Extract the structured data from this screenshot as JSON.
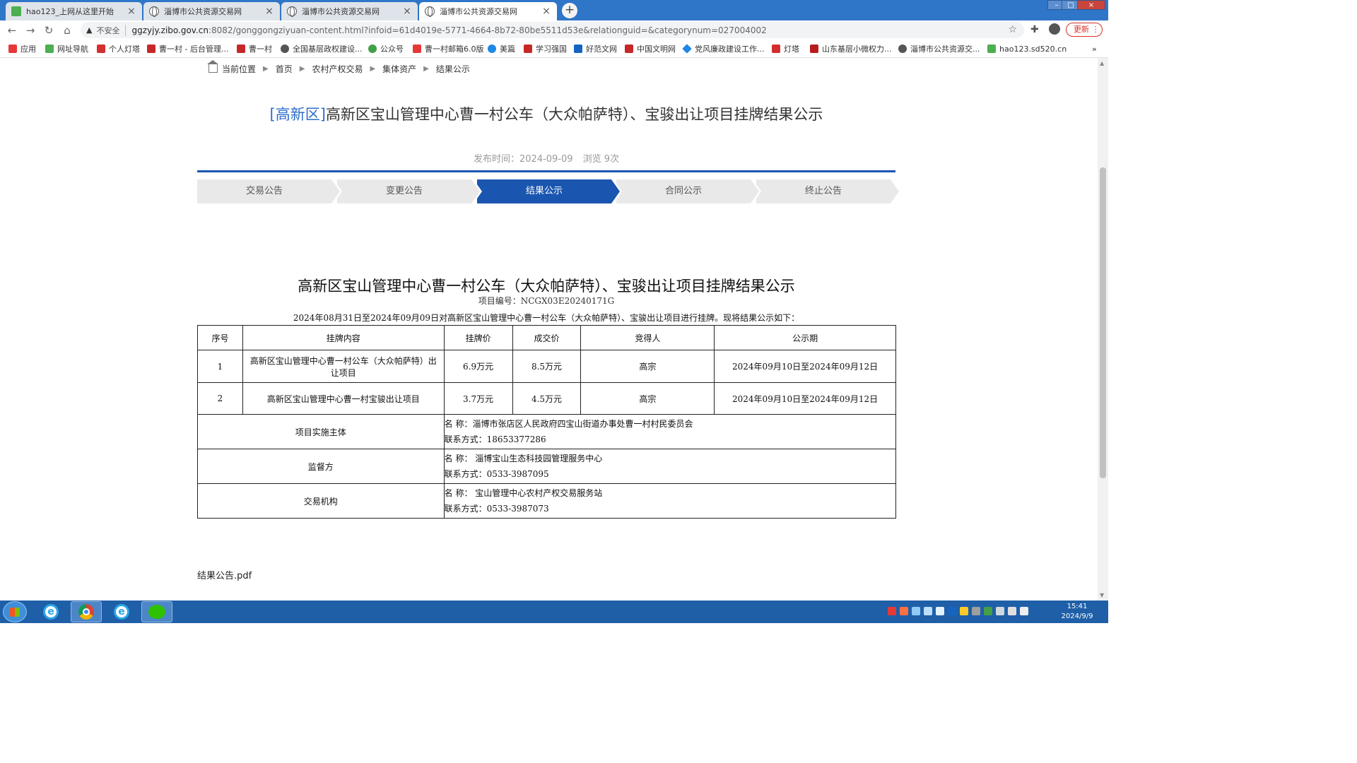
{
  "browser": {
    "tabs": [
      {
        "title": "hao123_上网从这里开始",
        "icon": "hao123-icon",
        "active": false
      },
      {
        "title": "淄博市公共资源交易网",
        "icon": "globe-icon",
        "active": false
      },
      {
        "title": "淄博市公共资源交易网",
        "icon": "globe-icon",
        "active": false
      },
      {
        "title": "淄博市公共资源交易网",
        "icon": "globe-icon",
        "active": true
      }
    ],
    "new_tab_label": "+",
    "close_glyph": "×",
    "window_controls": {
      "minimize": "–",
      "maximize": "□",
      "close": "×"
    },
    "nav": {
      "back": "←",
      "forward": "→",
      "reload": "↻",
      "home": "⌂"
    },
    "security_warning": "▲",
    "security_label": "不安全",
    "url_host": "ggzyjy.zibo.gov.cn",
    "url_rest": ":8082/gonggongziyuan-content.html?infoid=61d4019e-5771-4664-8b72-80be5511d53e&relationguid=&categorynum=027004002",
    "star_glyph": "☆",
    "extensions_glyph": "✚",
    "update_label": "更新 ⋮",
    "bookmarks": [
      {
        "label": "应用",
        "color": "#e53935"
      },
      {
        "label": "网址导航",
        "color": "#4caf50"
      },
      {
        "label": "个人灯塔",
        "color": "#d32f2f"
      },
      {
        "label": "曹一村 - 后台管理...",
        "color": "#c62828"
      },
      {
        "label": "曹一村",
        "color": "#c62828"
      },
      {
        "label": "全国基层政权建设...",
        "color": "#555555"
      },
      {
        "label": "公众号",
        "color": "#43a047"
      },
      {
        "label": "曹一村邮箱6.0版",
        "color": "#e53935"
      },
      {
        "label": "美篇",
        "color": "#1e88e5"
      },
      {
        "label": "学习强国",
        "color": "#c62828"
      },
      {
        "label": "好范文网",
        "color": "#1565c0"
      },
      {
        "label": "中国文明网",
        "color": "#c62828"
      },
      {
        "label": "党风廉政建设工作...",
        "color": "#1e88e5"
      },
      {
        "label": "灯塔",
        "color": "#d32f2f"
      },
      {
        "label": "山东基层小微权力...",
        "color": "#b71c1c"
      },
      {
        "label": "淄博市公共资源交...",
        "color": "#555555"
      },
      {
        "label": "hao123.sd520.cn",
        "color": "#4caf50"
      }
    ],
    "bookmarks_more": "»"
  },
  "breadcrumb": {
    "items": [
      "当前位置",
      "首页",
      "农村产权交易",
      "集体资产",
      "结果公示"
    ],
    "separator": "▶"
  },
  "header": {
    "district_tag": "[高新区]",
    "title": "高新区宝山管理中心曹一村公车（大众帕萨特）、宝骏出让项目挂牌结果公示",
    "publish_label": "发布时间：2024-09-09",
    "views_label": "浏览 9次"
  },
  "steps": [
    {
      "label": "交易公告",
      "active": false
    },
    {
      "label": "变更公告",
      "active": false
    },
    {
      "label": "结果公示",
      "active": true
    },
    {
      "label": "合同公示",
      "active": false
    },
    {
      "label": "终止公告",
      "active": false
    }
  ],
  "document": {
    "title": "高新区宝山管理中心曹一村公车（大众帕萨特）、宝骏出让项目挂牌结果公示",
    "project_code": "项目编号：NCGX03E20240171G",
    "intro": "2024年08月31日至2024年09月09日对高新区宝山管理中心曹一村公车（大众帕萨特）、宝骏出让项目进行挂牌。现将结果公示如下：",
    "table": {
      "headers": [
        "序号",
        "挂牌内容",
        "挂牌价",
        "成交价",
        "竞得人",
        "公示期"
      ],
      "rows": [
        {
          "no": "1",
          "content": "高新区宝山管理中心曹一村公车（大众帕萨特）出让项目",
          "list_price": "6.9万元",
          "deal_price": "8.5万元",
          "winner": "高宗",
          "period": "2024年09月10日至2024年09月12日"
        },
        {
          "no": "2",
          "content": "高新区宝山管理中心曹一村宝骏出让项目",
          "list_price": "3.7万元",
          "deal_price": "4.5万元",
          "winner": "高宗",
          "period": "2024年09月10日至2024年09月12日"
        }
      ],
      "info": [
        {
          "label": "项目实施主体",
          "name": "名 称：淄博市张店区人民政府四宝山街道办事处曹一村村民委员会",
          "contact": "联系方式：18653377286"
        },
        {
          "label": "监督方",
          "name": "名 称： 淄博宝山生态科技园管理服务中心",
          "contact": "联系方式：0533-3987095"
        },
        {
          "label": "交易机构",
          "name": "名 称： 宝山管理中心农村产权交易服务站",
          "contact": "联系方式：0533-3987073"
        }
      ]
    },
    "attachment": "结果公告.pdf"
  },
  "taskbar": {
    "clock_time": "15:41",
    "clock_date": "2024/9/9"
  }
}
